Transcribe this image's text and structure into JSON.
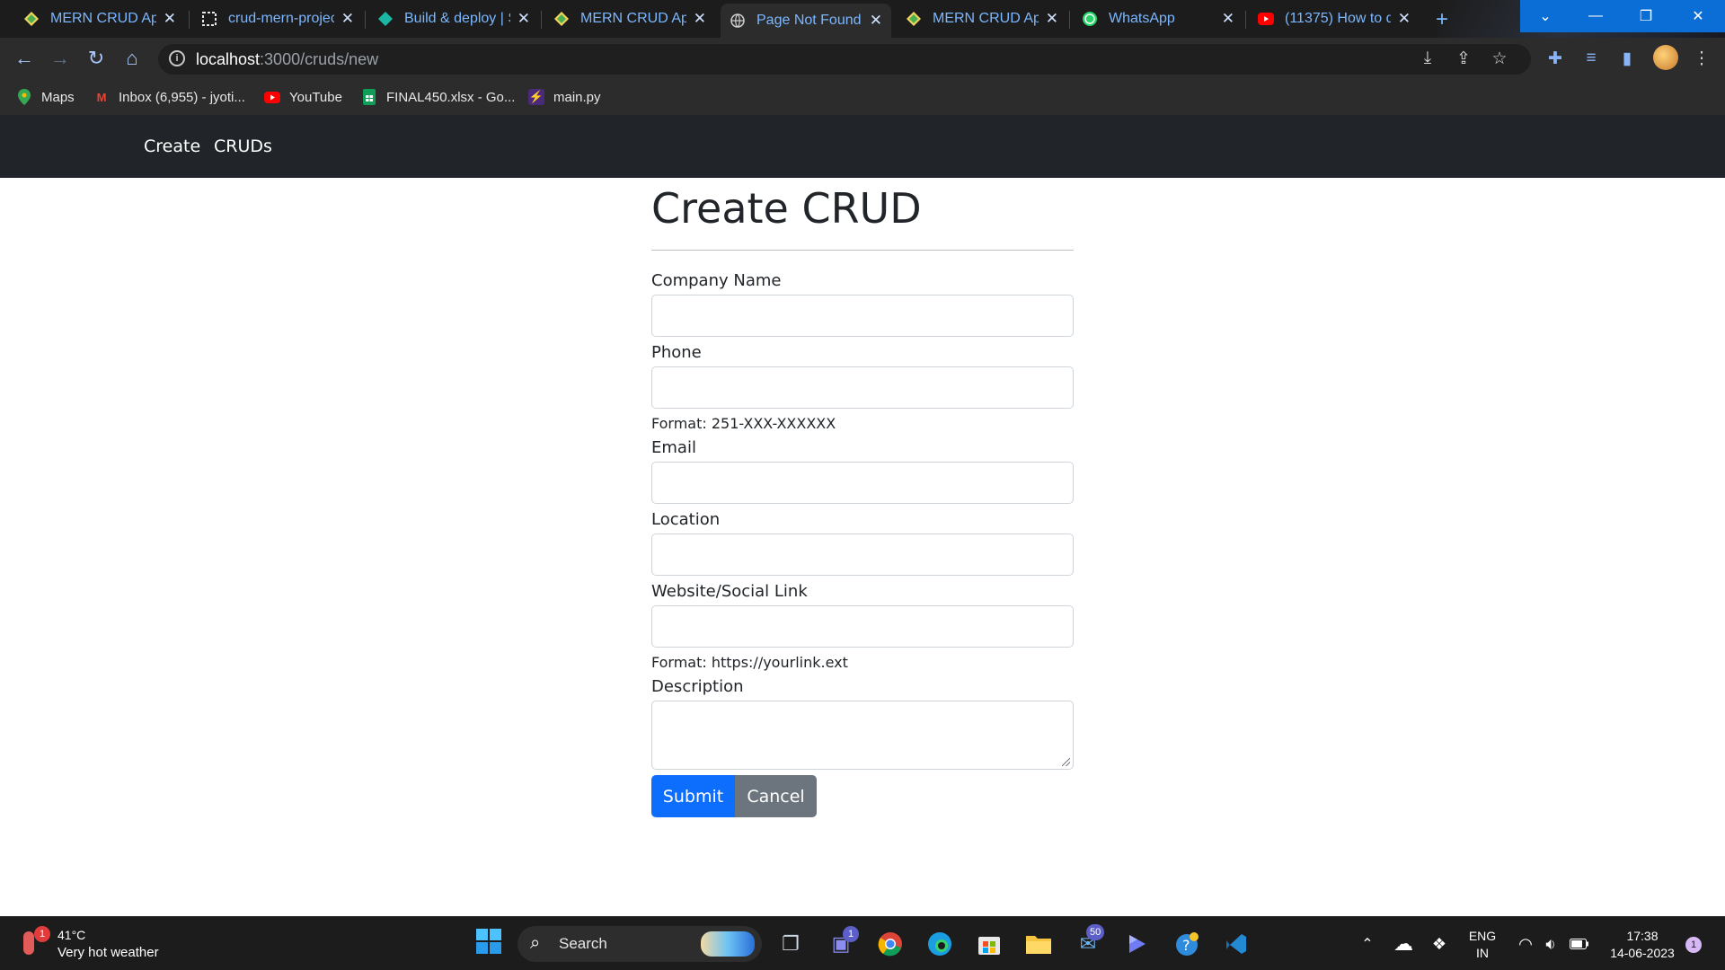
{
  "browser": {
    "tabs": [
      {
        "title": "MERN CRUD App",
        "icon": "mern-diamond-icon",
        "active": false
      },
      {
        "title": "crud-mern-projec",
        "icon": "code-sandbox-icon",
        "active": false
      },
      {
        "title": "Build & deploy | S",
        "icon": "render-diamond-icon",
        "active": false
      },
      {
        "title": "MERN CRUD App",
        "icon": "mern-diamond-icon",
        "active": false
      },
      {
        "title": "Page Not Found",
        "icon": "globe-icon",
        "active": true
      },
      {
        "title": "MERN CRUD App",
        "icon": "mern-diamond-icon",
        "active": false
      },
      {
        "title": "WhatsApp",
        "icon": "whatsapp-icon",
        "active": false
      },
      {
        "title": "(11375) How to d",
        "icon": "youtube-icon",
        "active": false
      }
    ],
    "address": {
      "host": "localhost",
      "path": ":3000/cruds/new"
    },
    "bookmarks": [
      {
        "label": "Maps",
        "icon": "maps-pin-icon"
      },
      {
        "label": "Inbox (6,955) - jyoti...",
        "icon": "gmail-icon"
      },
      {
        "label": "YouTube",
        "icon": "youtube-icon"
      },
      {
        "label": "FINAL450.xlsx - Go...",
        "icon": "sheets-icon"
      },
      {
        "label": "main.py",
        "icon": "replit-bolt-icon"
      }
    ]
  },
  "app": {
    "nav": {
      "create": "Create",
      "cruds": "CRUDs"
    },
    "page_title": "Create CRUD",
    "form": {
      "company_label": "Company Name",
      "phone_label": "Phone",
      "phone_hint": "Format: 251-XXX-XXXXXX",
      "email_label": "Email",
      "location_label": "Location",
      "website_label": "Website/Social Link",
      "website_hint": "Format: https://yourlink.ext",
      "description_label": "Description",
      "submit": "Submit",
      "cancel": "Cancel"
    },
    "colors": {
      "navbar": "#212529",
      "primary": "#0d6efd",
      "secondary": "#6c757d"
    }
  },
  "taskbar": {
    "weather": {
      "temp": "41°C",
      "desc": "Very hot weather",
      "badge": "1"
    },
    "search_label": "Search",
    "badges": {
      "teams": "1",
      "mail": "50"
    },
    "language": {
      "top": "ENG",
      "bottom": "IN"
    },
    "time": "17:38",
    "date": "14-06-2023",
    "notification_count": "1"
  }
}
